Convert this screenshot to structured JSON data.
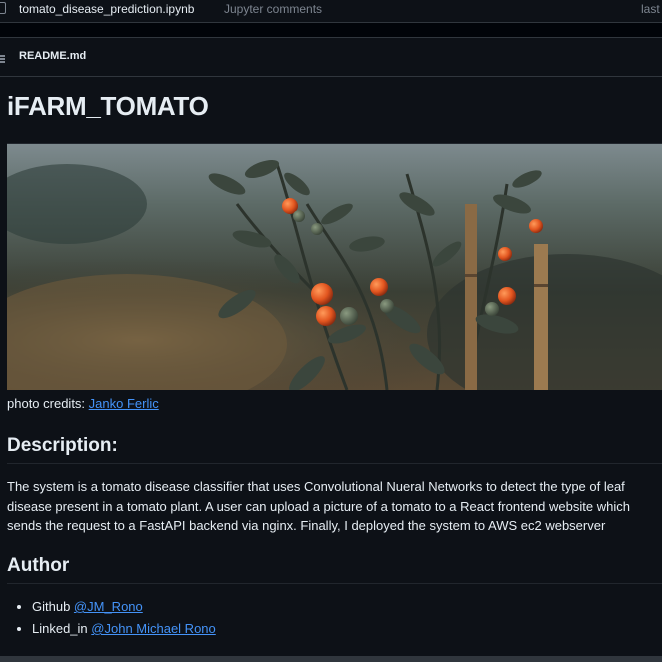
{
  "file_row": {
    "filename": "tomato_disease_prediction.ipynb",
    "commit_message": "Jupyter comments",
    "last_col": "last"
  },
  "readme_bar": {
    "title": "README.md"
  },
  "readme": {
    "title": "iFARM_TOMATO",
    "photo_credits_label": "photo credits: ",
    "photo_credits_link": "Janko Ferlic",
    "description_heading": "Description:",
    "description_text": "The system is a tomato disease classifier that uses Convolutional Nueral Networks to detect the type of leaf disease present in a tomato plant. A user can upload a picture of a tomato to a React frontend website which sends the request to a FastAPI backend via nginx. Finally, I deployed the system to AWS ec2 webserver",
    "author_heading": "Author",
    "author_items": [
      {
        "label": "Github ",
        "link": "@JM_Rono"
      },
      {
        "label": "Linked_in ",
        "link": "@John Michael Rono"
      }
    ]
  },
  "colors": {
    "background": "#0d1117",
    "link": "#4493f8",
    "border": "#30363d",
    "muted_text": "#7d8590"
  },
  "icons": [
    "file-icon",
    "list-icon"
  ]
}
